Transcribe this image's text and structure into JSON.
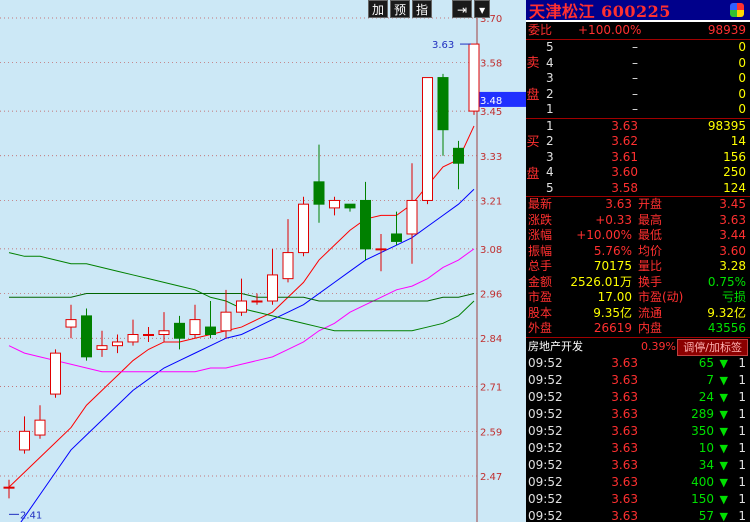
{
  "toolbar": {
    "add": "加",
    "predict": "预",
    "index": "指",
    "arrow_icon": "right-arrow-icon",
    "dropdown_icon": "dropdown-arrow-icon"
  },
  "price_axis": {
    "ticks": [
      "3.70",
      "3.58",
      "3.45",
      "3.33",
      "3.21",
      "3.08",
      "2.96",
      "2.84",
      "2.71",
      "2.59",
      "2.47"
    ],
    "current": "3.48"
  },
  "chart_annotations": {
    "high": "3.63",
    "low": "2.41"
  },
  "chart_data": {
    "type": "candlestick",
    "title": "",
    "ylim": [
      2.38,
      3.72
    ],
    "candles": [
      {
        "o": 2.44,
        "h": 2.46,
        "l": 2.41,
        "c": 2.44
      },
      {
        "o": 2.54,
        "h": 2.63,
        "l": 2.53,
        "c": 2.59
      },
      {
        "o": 2.58,
        "h": 2.66,
        "l": 2.57,
        "c": 2.62
      },
      {
        "o": 2.69,
        "h": 2.81,
        "l": 2.68,
        "c": 2.8
      },
      {
        "o": 2.87,
        "h": 2.93,
        "l": 2.84,
        "c": 2.89
      },
      {
        "o": 2.9,
        "h": 2.92,
        "l": 2.78,
        "c": 2.79
      },
      {
        "o": 2.81,
        "h": 2.86,
        "l": 2.79,
        "c": 2.82
      },
      {
        "o": 2.82,
        "h": 2.85,
        "l": 2.8,
        "c": 2.83
      },
      {
        "o": 2.83,
        "h": 2.89,
        "l": 2.82,
        "c": 2.85
      },
      {
        "o": 2.85,
        "h": 2.87,
        "l": 2.83,
        "c": 2.85
      },
      {
        "o": 2.85,
        "h": 2.91,
        "l": 2.83,
        "c": 2.86
      },
      {
        "o": 2.88,
        "h": 2.9,
        "l": 2.81,
        "c": 2.84
      },
      {
        "o": 2.85,
        "h": 2.93,
        "l": 2.84,
        "c": 2.89
      },
      {
        "o": 2.87,
        "h": 2.94,
        "l": 2.84,
        "c": 2.85
      },
      {
        "o": 2.86,
        "h": 2.97,
        "l": 2.84,
        "c": 2.91
      },
      {
        "o": 2.91,
        "h": 3.0,
        "l": 2.9,
        "c": 2.94
      },
      {
        "o": 2.94,
        "h": 2.96,
        "l": 2.93,
        "c": 2.94
      },
      {
        "o": 2.94,
        "h": 3.08,
        "l": 2.93,
        "c": 3.01
      },
      {
        "o": 3.0,
        "h": 3.16,
        "l": 2.99,
        "c": 3.07
      },
      {
        "o": 3.07,
        "h": 3.22,
        "l": 3.06,
        "c": 3.2
      },
      {
        "o": 3.26,
        "h": 3.36,
        "l": 3.15,
        "c": 3.2
      },
      {
        "o": 3.19,
        "h": 3.22,
        "l": 3.17,
        "c": 3.21
      },
      {
        "o": 3.2,
        "h": 3.2,
        "l": 3.18,
        "c": 3.19
      },
      {
        "o": 3.21,
        "h": 3.26,
        "l": 3.05,
        "c": 3.08
      },
      {
        "o": 3.08,
        "h": 3.12,
        "l": 3.02,
        "c": 3.08
      },
      {
        "o": 3.12,
        "h": 3.18,
        "l": 3.09,
        "c": 3.1
      },
      {
        "o": 3.12,
        "h": 3.31,
        "l": 3.04,
        "c": 3.21
      },
      {
        "o": 3.21,
        "h": 3.54,
        "l": 3.2,
        "c": 3.54
      },
      {
        "o": 3.54,
        "h": 3.55,
        "l": 3.33,
        "c": 3.4
      },
      {
        "o": 3.35,
        "h": 3.37,
        "l": 3.24,
        "c": 3.31
      },
      {
        "o": 3.45,
        "h": 3.63,
        "l": 3.44,
        "c": 3.63
      }
    ],
    "moving_averages": [
      {
        "color": "#ff0000",
        "values": [
          2.44,
          2.48,
          2.52,
          2.56,
          2.6,
          2.66,
          2.7,
          2.74,
          2.78,
          2.81,
          2.83,
          2.83,
          2.84,
          2.85,
          2.86,
          2.87,
          2.89,
          2.91,
          2.95,
          2.99,
          3.05,
          3.09,
          3.13,
          3.16,
          3.17,
          3.17,
          3.2,
          3.25,
          3.3,
          3.32,
          3.41
        ]
      },
      {
        "color": "#0000ff",
        "values": [
          2.3,
          2.36,
          2.42,
          2.48,
          2.54,
          2.58,
          2.62,
          2.66,
          2.7,
          2.73,
          2.76,
          2.78,
          2.8,
          2.82,
          2.84,
          2.85,
          2.87,
          2.89,
          2.91,
          2.93,
          2.96,
          2.99,
          3.02,
          3.05,
          3.07,
          3.09,
          3.11,
          3.14,
          3.17,
          3.2,
          3.24
        ]
      },
      {
        "color": "#ff00ff",
        "values": [
          2.82,
          2.8,
          2.79,
          2.78,
          2.77,
          2.76,
          2.75,
          2.75,
          2.75,
          2.75,
          2.75,
          2.75,
          2.75,
          2.76,
          2.76,
          2.77,
          2.78,
          2.79,
          2.81,
          2.83,
          2.86,
          2.88,
          2.91,
          2.93,
          2.95,
          2.97,
          2.98,
          3.0,
          3.03,
          3.05,
          3.08
        ]
      },
      {
        "color": "#008000",
        "values": [
          3.07,
          3.06,
          3.06,
          3.05,
          3.04,
          3.04,
          3.03,
          3.02,
          3.01,
          3.0,
          2.99,
          2.98,
          2.97,
          2.95,
          2.94,
          2.92,
          2.91,
          2.9,
          2.89,
          2.88,
          2.87,
          2.86,
          2.86,
          2.86,
          2.86,
          2.86,
          2.86,
          2.87,
          2.88,
          2.9,
          2.94
        ]
      },
      {
        "color": "#006400",
        "values": [
          2.95,
          2.95,
          2.95,
          2.95,
          2.95,
          2.96,
          2.96,
          2.96,
          2.96,
          2.96,
          2.96,
          2.96,
          2.96,
          2.96,
          2.96,
          2.96,
          2.95,
          2.95,
          2.95,
          2.95,
          2.94,
          2.94,
          2.94,
          2.94,
          2.94,
          2.94,
          2.94,
          2.94,
          2.95,
          2.95,
          2.96
        ]
      }
    ]
  },
  "panel": {
    "stock_title": "天津松江 600225",
    "weibi": {
      "label": "委比",
      "pct": "+100.00%",
      "value": "98939"
    },
    "sell_label": [
      "卖",
      "盘"
    ],
    "sell": [
      {
        "level": "5",
        "price": "–",
        "vol": "0"
      },
      {
        "level": "4",
        "price": "–",
        "vol": "0"
      },
      {
        "level": "3",
        "price": "–",
        "vol": "0"
      },
      {
        "level": "2",
        "price": "–",
        "vol": "0"
      },
      {
        "level": "1",
        "price": "–",
        "vol": "0"
      }
    ],
    "buy_label": [
      "买",
      "盘"
    ],
    "buy": [
      {
        "level": "1",
        "price": "3.63",
        "vol": "98395"
      },
      {
        "level": "2",
        "price": "3.62",
        "vol": "14"
      },
      {
        "level": "3",
        "price": "3.61",
        "vol": "156"
      },
      {
        "level": "4",
        "price": "3.60",
        "vol": "250"
      },
      {
        "level": "5",
        "price": "3.58",
        "vol": "124"
      }
    ],
    "quote": [
      {
        "l": "最新",
        "lv": "3.63",
        "r": "开盘",
        "rv": "3.45"
      },
      {
        "l": "涨跌",
        "lv": "+0.33",
        "r": "最高",
        "rv": "3.63"
      },
      {
        "l": "涨幅",
        "lv": "+10.00%",
        "r": "最低",
        "rv": "3.44"
      },
      {
        "l": "振幅",
        "lv": "5.76%",
        "r": "均价",
        "rv": "3.60"
      },
      {
        "l": "总手",
        "lv": "70175",
        "r": "量比",
        "rv": "3.28"
      },
      {
        "l": "金额",
        "lv": "2526.01万",
        "r": "换手",
        "rv": "0.75%"
      },
      {
        "l": "市盈",
        "lv": "17.00",
        "r": "市盈(动)",
        "rv": "亏损"
      },
      {
        "l": "股本",
        "lv": "9.35亿",
        "r": "流通",
        "rv": "9.32亿"
      },
      {
        "l": "外盘",
        "lv": "26619",
        "r": "内盘",
        "rv": "43556"
      }
    ],
    "sector": {
      "name": "房地产开发",
      "pct": "0.39%",
      "button": "调停/加标签"
    },
    "ticks": [
      {
        "t": "09:52",
        "p": "3.63",
        "v": "65",
        "n": "1"
      },
      {
        "t": "09:52",
        "p": "3.63",
        "v": "7",
        "n": "1"
      },
      {
        "t": "09:52",
        "p": "3.63",
        "v": "24",
        "n": "1"
      },
      {
        "t": "09:52",
        "p": "3.63",
        "v": "289",
        "n": "1"
      },
      {
        "t": "09:52",
        "p": "3.63",
        "v": "350",
        "n": "1"
      },
      {
        "t": "09:52",
        "p": "3.63",
        "v": "10",
        "n": "1"
      },
      {
        "t": "09:52",
        "p": "3.63",
        "v": "34",
        "n": "1"
      },
      {
        "t": "09:52",
        "p": "3.63",
        "v": "400",
        "n": "1"
      },
      {
        "t": "09:52",
        "p": "3.63",
        "v": "150",
        "n": "1"
      },
      {
        "t": "09:52",
        "p": "3.63",
        "v": "57",
        "n": "1"
      }
    ]
  }
}
